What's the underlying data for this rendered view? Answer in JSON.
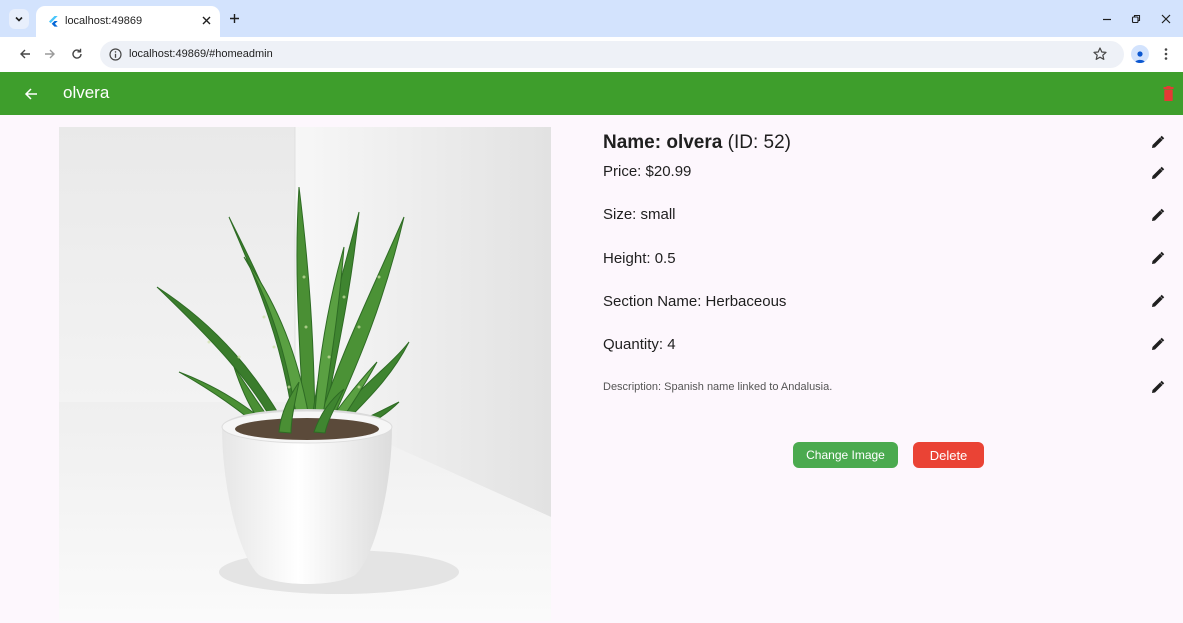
{
  "browser": {
    "tab_title": "localhost:49869",
    "url": "localhost:49869/#homeadmin"
  },
  "app": {
    "title": "olvera",
    "colors": {
      "appbar": "#3e9e2c",
      "change_button": "#4baa4f",
      "delete_button": "#ea4335",
      "trash_icon": "#e53935",
      "background": "#fdf7fd"
    }
  },
  "plant": {
    "name_label": "Name:",
    "name_value": "olvera",
    "id_text": "(ID: 52)",
    "price": "Price: $20.99",
    "size": "Size: small",
    "height": "Height: 0.5",
    "section": "Section Name: Herbaceous",
    "quantity": "Quantity: 4",
    "description": "Description: Spanish name linked to Andalusia."
  },
  "actions": {
    "change_image": "Change Image",
    "delete": "Delete"
  }
}
